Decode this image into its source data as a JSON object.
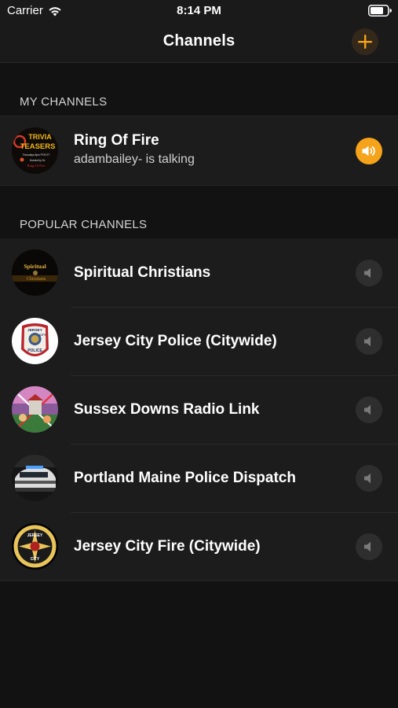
{
  "status_bar": {
    "carrier": "Carrier",
    "time": "8:14 PM",
    "wifi_icon": "wifi-icon",
    "battery_icon": "battery-icon"
  },
  "nav": {
    "title": "Channels",
    "add_icon": "plus-icon"
  },
  "colors": {
    "accent": "#f5a31a",
    "background": "#121212",
    "row_background": "#1c1c1c",
    "inactive_button": "#2e2e2e"
  },
  "my_channels": {
    "header": "MY CHANNELS",
    "items": [
      {
        "title": "Ring Of Fire",
        "subtitle": "adambailey- is talking",
        "avatar_text": [
          "TRIVIA",
          "TEASERS",
          "Thursdays 8pm PT/5 ET",
          "Hosted by Dr.",
          "Ring Of Fire"
        ],
        "speaker_state": "active"
      }
    ]
  },
  "popular_channels": {
    "header": "POPULAR CHANNELS",
    "items": [
      {
        "title": "Spiritual Christians",
        "speaker_state": "inactive",
        "avatar_text": [
          "Spiritual",
          "Christians"
        ]
      },
      {
        "title": "Jersey City Police (Citywide)",
        "speaker_state": "inactive",
        "avatar_text": [
          "JERSEY",
          "CITY",
          "POLICE"
        ]
      },
      {
        "title": "Sussex Downs Radio Link",
        "speaker_state": "inactive"
      },
      {
        "title": "Portland Maine Police Dispatch",
        "speaker_state": "inactive"
      },
      {
        "title": "Jersey City Fire (Citywide)",
        "speaker_state": "inactive",
        "avatar_text": [
          "JERSEY",
          "CITY"
        ]
      }
    ]
  }
}
